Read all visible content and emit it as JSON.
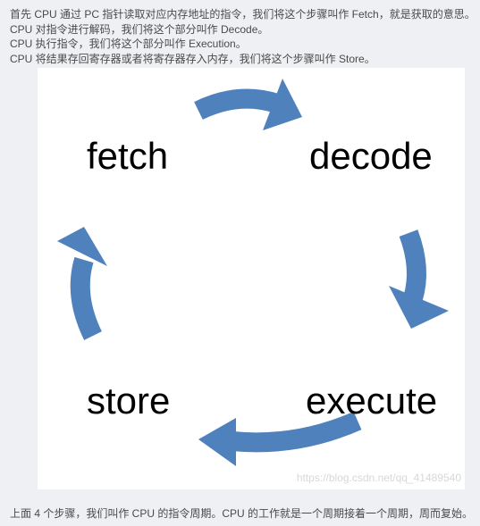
{
  "intro_lines": [
    "首先 CPU 通过 PC 指针读取对应内存地址的指令，我们将这个步骤叫作 Fetch，就是获取的意思。",
    "CPU 对指令进行解码，我们将这个部分叫作 Decode。",
    "CPU 执行指令，我们将这个部分叫作 Execution。",
    "CPU 将结果存回寄存器或者将寄存器存入内存，我们将这个步骤叫作 Store。"
  ],
  "figure": {
    "stages": {
      "fetch": "fetch",
      "decode": "decode",
      "execute": "execute",
      "store": "store"
    },
    "arrow_color": "#4f81bd",
    "watermark": "https://blog.csdn.net/qq_41489540"
  },
  "footer": "上面 4 个步骤，我们叫作 CPU 的指令周期。CPU 的工作就是一个周期接着一个周期，周而复始。"
}
